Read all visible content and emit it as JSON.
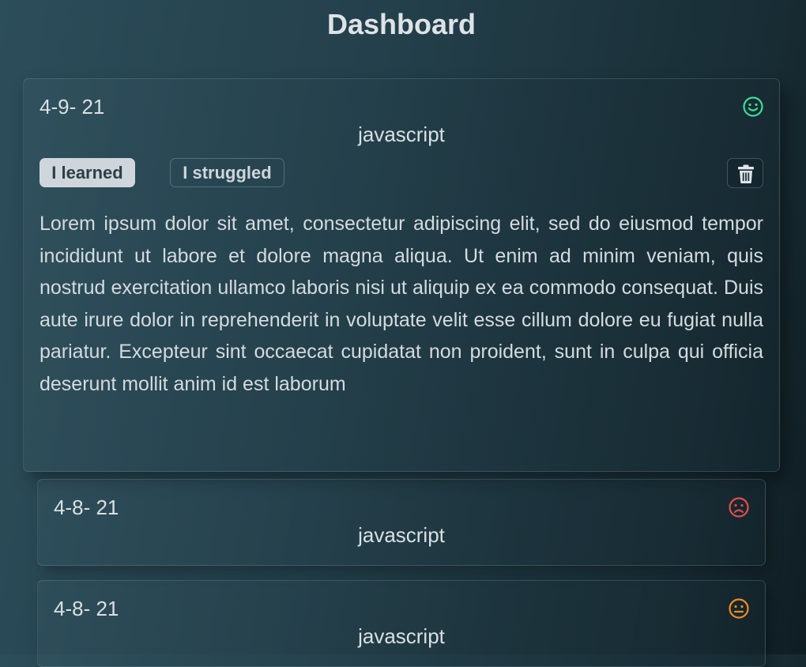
{
  "header": {
    "title": "Dashboard"
  },
  "entries": [
    {
      "date": "4-9- 21",
      "topic": "javascript",
      "mood": "happy-face-icon",
      "mood_color": "#3ddc97",
      "tags": {
        "learned_label": "I learned",
        "struggled_label": "I struggled",
        "active": "learned"
      },
      "delete_icon": "trash-icon",
      "body": "Lorem ipsum dolor sit amet, consectetur adipiscing elit, sed do eiusmod tempor incididunt ut labore et dolore magna aliqua. Ut enim ad minim veniam, quis nostrud exercitation ullamco laboris nisi ut aliquip ex ea commodo consequat. Duis aute irure dolor in reprehenderit in voluptate velit esse cillum dolore eu fugiat nulla pariatur. Excepteur sint occaecat cupidatat non proident, sunt in culpa qui officia deserunt mollit anim id est laborum"
    },
    {
      "date": "4-8- 21",
      "topic": "javascript",
      "mood": "sad-face-icon",
      "mood_color": "#e74c4c"
    },
    {
      "date": "4-8- 21",
      "topic": "javascript",
      "mood": "neutral-face-icon",
      "mood_color": "#f08a24"
    }
  ]
}
